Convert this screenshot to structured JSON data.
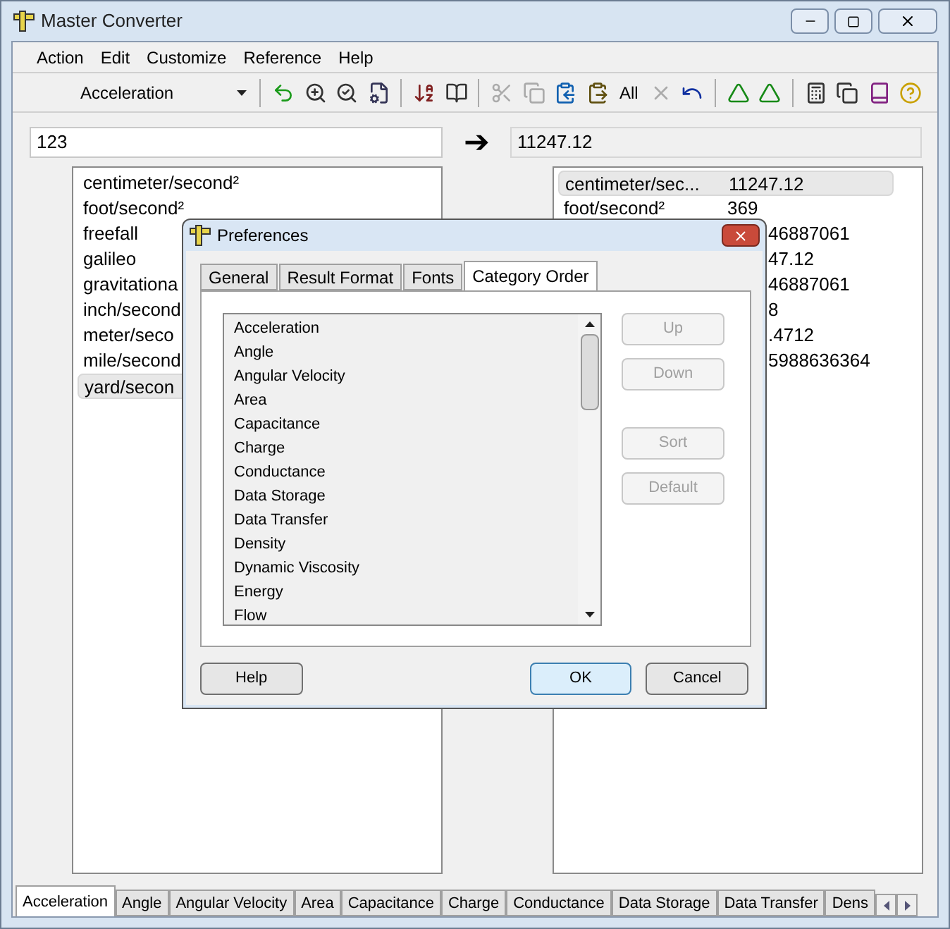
{
  "window": {
    "title": "Master Converter"
  },
  "menu": [
    "Action",
    "Edit",
    "Customize",
    "Reference",
    "Help"
  ],
  "toolbar": {
    "category": "Acceleration",
    "all_label": "All"
  },
  "input": {
    "value": "123"
  },
  "arrow": "➔",
  "result": {
    "value": "11247.12"
  },
  "left_list": [
    {
      "text": "centimeter/second²",
      "selected": false
    },
    {
      "text": "foot/second²",
      "selected": false
    },
    {
      "text": "freefall",
      "selected": false
    },
    {
      "text": "galileo",
      "selected": false
    },
    {
      "text": "gravitationa",
      "selected": false
    },
    {
      "text": "inch/second",
      "selected": false
    },
    {
      "text": "meter/seco",
      "selected": false
    },
    {
      "text": "mile/second",
      "selected": false
    },
    {
      "text": "yard/secon",
      "selected": true
    }
  ],
  "right_list": [
    {
      "kind": "full",
      "name": "centimeter/sec...",
      "value": "11247.12",
      "selected": true
    },
    {
      "kind": "full",
      "name": "foot/second²",
      "value": "369",
      "selected": false
    },
    {
      "kind": "partial",
      "value": "46887061",
      "selected": false
    },
    {
      "kind": "partial",
      "value": "47.12",
      "selected": false
    },
    {
      "kind": "partial",
      "value": "46887061",
      "selected": false
    },
    {
      "kind": "partial",
      "value": "8",
      "selected": false
    },
    {
      "kind": "partial",
      "value": ".4712",
      "selected": false
    },
    {
      "kind": "partial",
      "value": "5988636364",
      "selected": false
    }
  ],
  "bottom_tabs": [
    {
      "label": "Acceleration",
      "selected": true
    },
    {
      "label": "Angle",
      "selected": false
    },
    {
      "label": "Angular Velocity",
      "selected": false
    },
    {
      "label": "Area",
      "selected": false
    },
    {
      "label": "Capacitance",
      "selected": false
    },
    {
      "label": "Charge",
      "selected": false
    },
    {
      "label": "Conductance",
      "selected": false
    },
    {
      "label": "Data Storage",
      "selected": false
    },
    {
      "label": "Data Transfer",
      "selected": false
    },
    {
      "label": "Dens",
      "selected": false
    }
  ],
  "dialog": {
    "title": "Preferences",
    "tabs": [
      {
        "label": "General",
        "selected": false
      },
      {
        "label": "Result Format",
        "selected": false
      },
      {
        "label": "Fonts",
        "selected": false
      },
      {
        "label": "Category Order",
        "selected": true
      }
    ],
    "categories": [
      "Acceleration",
      "Angle",
      "Angular Velocity",
      "Area",
      "Capacitance",
      "Charge",
      "Conductance",
      "Data Storage",
      "Data Transfer",
      "Density",
      "Dynamic Viscosity",
      "Energy",
      "Flow"
    ],
    "side_buttons": [
      {
        "label": "Up",
        "disabled": true
      },
      {
        "label": "Down",
        "disabled": true
      },
      {
        "label": "Sort",
        "disabled": true
      },
      {
        "label": "Default",
        "disabled": true
      }
    ],
    "buttons": [
      {
        "label": "Help",
        "default": false
      },
      {
        "label": "OK",
        "default": true
      },
      {
        "label": "Cancel",
        "default": false
      }
    ]
  }
}
